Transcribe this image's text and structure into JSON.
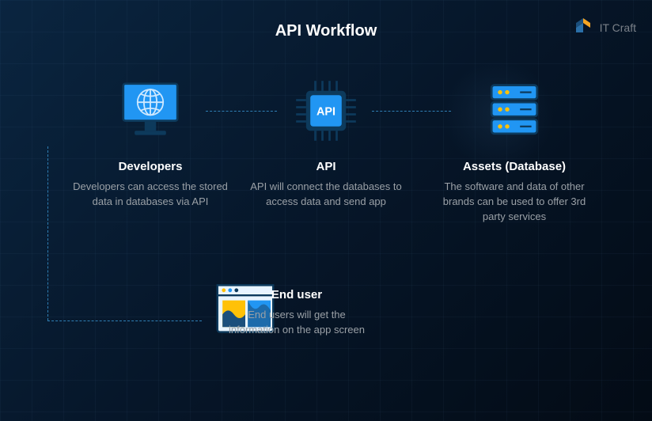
{
  "title": "API Workflow",
  "brand": "IT Craft",
  "nodes": {
    "developers": {
      "title": "Developers",
      "desc": "Developers can access the stored data in databases via API"
    },
    "api": {
      "title": "API",
      "desc": "API will connect the databases to access data and send app",
      "chip_label": "API"
    },
    "assets": {
      "title": "Assets (Database)",
      "desc": "The software and data of other brands can be used to offer 3rd party services"
    },
    "enduser": {
      "title": "End user",
      "desc": "End users will get the information on the app screen"
    }
  }
}
